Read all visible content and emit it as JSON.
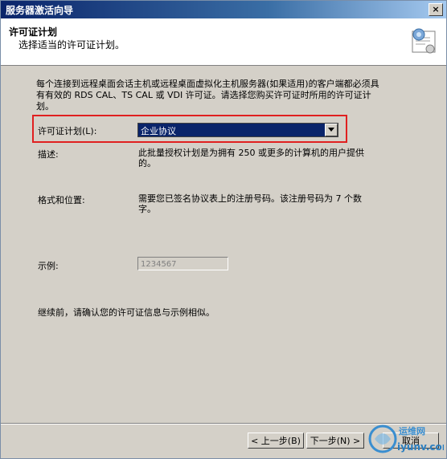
{
  "window": {
    "title": "服务器激活向导",
    "close_label": "×"
  },
  "header": {
    "title": "许可证计划",
    "subtitle": "选择适当的许可证计划。"
  },
  "intro": "每个连接到远程桌面会话主机或远程桌面虚拟化主机服务器(如果适用)的客户端都必须具有有效的 RDS CAL、TS CAL 或 VDI 许可证。请选择您购买许可证时所用的许可证计划。",
  "license_plan": {
    "label": "许可证计划(L):",
    "selected": "企业协议"
  },
  "description": {
    "label": "描述:",
    "text": "此批量授权计划是为拥有 250 或更多的计算机的用户提供的。"
  },
  "format": {
    "label": "格式和位置:",
    "text": "需要您已签名协议表上的注册号码。该注册号码为 7 个数字。"
  },
  "sample": {
    "label": "示例:",
    "value": "1234567"
  },
  "confirm_text": "继续前，请确认您的许可证信息与示例相似。",
  "buttons": {
    "back": "< 上一步(B)",
    "next": "下一步(N) >",
    "cancel": "取消"
  },
  "watermark": {
    "text": "运维网",
    "url": "iyunv.com"
  }
}
